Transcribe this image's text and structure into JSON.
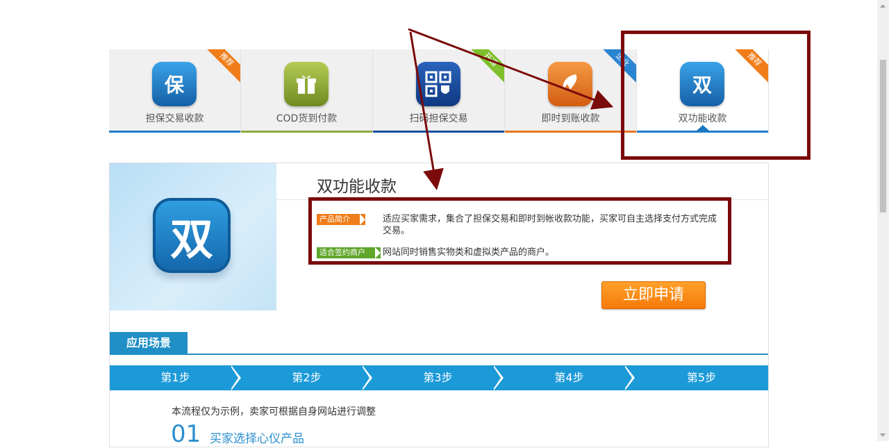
{
  "tabs": [
    {
      "label": "担保交易收款",
      "icon_name": "shield-icon",
      "icon_text": "保",
      "icon_color": "#1f7cc9",
      "ribbon": "推荐",
      "ribbon_color": "#f07d1a",
      "underline": "#1f7cc9"
    },
    {
      "label": "COD货到付款",
      "icon_name": "gift-box-icon",
      "icon_text": "",
      "icon_color": "#8fa93a",
      "ribbon": "",
      "ribbon_color": "#f07d1a",
      "underline": "#8fa93a"
    },
    {
      "label": "扫码担保交易",
      "icon_name": "qr-code-icon",
      "icon_text": "",
      "icon_color": "#1a4fa0",
      "ribbon": "开通",
      "ribbon_color": "#7fbf2b",
      "underline": "#1a4fa0"
    },
    {
      "label": "即时到账收款",
      "icon_name": "lightning-icon",
      "icon_text": "",
      "icon_color": "#e8731d",
      "ribbon": "企业",
      "ribbon_color": "#2a85d0",
      "underline": "#e8731d"
    },
    {
      "label": "双功能收款",
      "icon_name": "dual-function-icon",
      "icon_text": "双",
      "icon_color": "#1f7cc9",
      "ribbon": "推荐",
      "ribbon_color": "#f07d1a",
      "underline": "#1f7cc9",
      "active": true
    }
  ],
  "product": {
    "hero_icon_text": "双",
    "title": "双功能收款",
    "intro_tag": "产品简介",
    "intro_text": "适应买家需求，集合了担保交易和即时到帐收款功能，买家可自主选择支付方式完成交易。",
    "merchant_tag": "适合签约商户",
    "merchant_text": "网站同时销售实物类和虚拟类产品的商户。",
    "apply_label": "立即申请"
  },
  "scenario": {
    "tab_label": "应用场景",
    "steps": [
      "第1步",
      "第2步",
      "第3步",
      "第4步",
      "第5步"
    ],
    "note": "本流程仅为示例，卖家可根据自身网站进行调整",
    "first_step_number": "01",
    "first_step_title": "买家选择心仪产品"
  },
  "colors": {
    "accent_blue": "#1c9ad8",
    "annotation": "#7b0a0a",
    "tag_orange": "#f07d1a",
    "tag_green": "#5fa62a"
  }
}
